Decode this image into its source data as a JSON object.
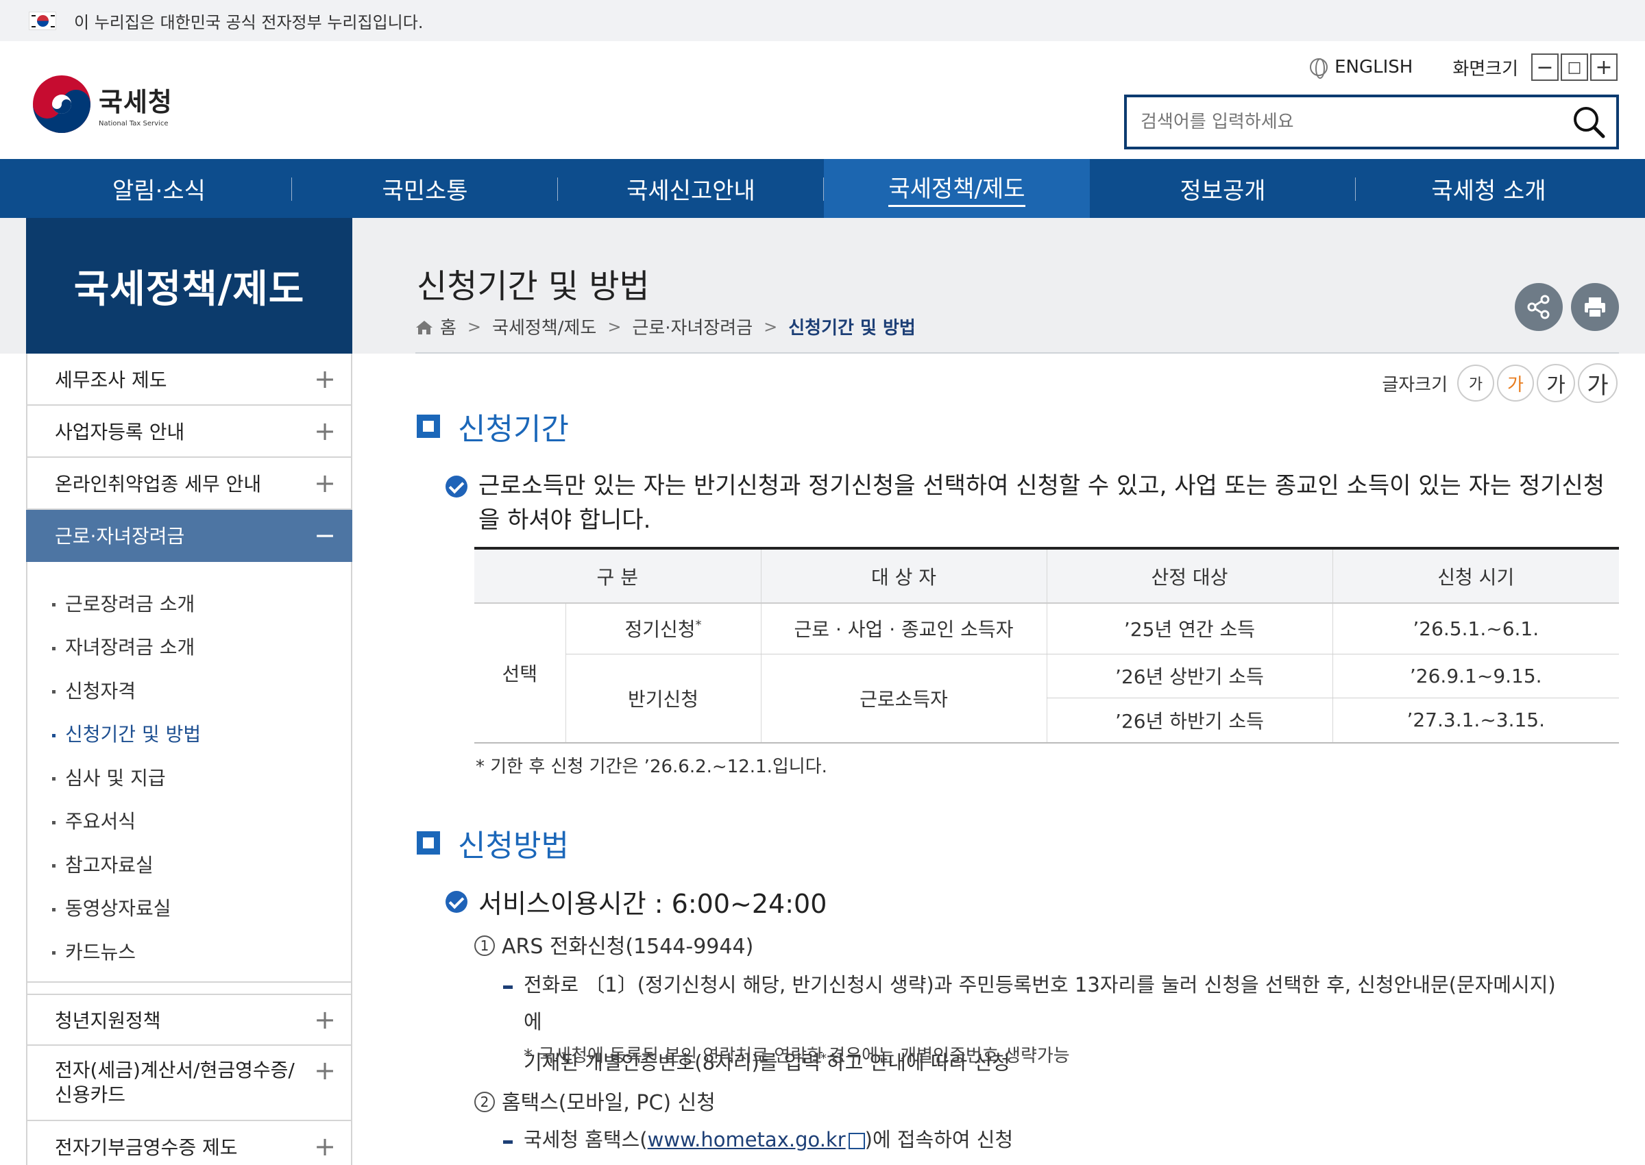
{
  "gov_banner": {
    "text": "이 누리집은 대한민국 공식 전자정부 누리집입니다."
  },
  "header": {
    "logo_ko": "국세청",
    "logo_en": "National Tax Service",
    "english_label": "ENGLISH",
    "zoom_label": "화면크기",
    "zoom_out": "−",
    "zoom_reset": "□",
    "zoom_in": "+",
    "search_placeholder": "검색어를 입력하세요"
  },
  "gnb": {
    "items": [
      {
        "label": "알림·소식"
      },
      {
        "label": "국민소통"
      },
      {
        "label": "국세신고안내"
      },
      {
        "label": "국세정책/제도",
        "active": true
      },
      {
        "label": "정보공개"
      },
      {
        "label": "국세청 소개"
      }
    ]
  },
  "lnb": {
    "title": "국세정책/제도",
    "items": [
      {
        "label": "세무조사 제도",
        "icon": "+"
      },
      {
        "label": "사업자등록 안내",
        "icon": "+"
      },
      {
        "label": "온라인취약업종 세무 안내",
        "icon": "+"
      },
      {
        "label": "근로·자녀장려금",
        "icon": "−",
        "active": true
      }
    ],
    "sub_items": [
      {
        "label": "근로장려금 소개"
      },
      {
        "label": "자녀장려금 소개"
      },
      {
        "label": "신청자격"
      },
      {
        "label": "신청기간 및 방법",
        "active": true
      },
      {
        "label": "심사 및 지급"
      },
      {
        "label": "주요서식"
      },
      {
        "label": "참고자료실"
      },
      {
        "label": "동영상자료실"
      },
      {
        "label": "카드뉴스"
      }
    ],
    "items_after": [
      {
        "label": "청년지원정책",
        "icon": "+"
      },
      {
        "label": "전자(세금)계산서/현금영수증/\n신용카드",
        "icon": "+"
      },
      {
        "label": "전자기부금영수증 제도",
        "icon": "+"
      }
    ]
  },
  "content": {
    "title": "신청기간 및 방법",
    "breadcrumb": [
      "홈",
      "국세정책/제도",
      "근로·자녀장려금",
      "신청기간 및 방법"
    ],
    "fontsize_label": "글자크기",
    "fontsize_buttons": [
      "가",
      "가",
      "가",
      "가"
    ],
    "section1": {
      "heading": "신청기간",
      "text": "근로소득만 있는 자는 반기신청과 정기신청을 선택하여 신청할 수 있고, 사업 또는 종교인 소득이 있는 자는 정기신청을 하셔야 합니다.",
      "table": {
        "headers": [
          "구 분",
          "대 상 자",
          "산정 대상",
          "신청 시기"
        ],
        "group": "선택",
        "rows": [
          {
            "type": "정기신청",
            "sup": "*",
            "target": "근로 · 사업 · 종교인 소득자",
            "basis": "’25년 연간 소득",
            "period": "’26.5.1.~6.1."
          },
          {
            "type": "반기신청",
            "target": "근로소득자",
            "basis": "’26년 상반기 소득",
            "period": "’26.9.1~9.15."
          },
          {
            "basis": "’26년 하반기 소득",
            "period": "’27.3.1.~3.15."
          }
        ]
      },
      "note": "* 기한 후 신청 기간은 ’26.6.2.~12.1.입니다."
    },
    "section2": {
      "heading": "신청방법",
      "service_time": "서비스이용시간 : 6:00~24:00",
      "method1": {
        "num": "1",
        "title": "ARS 전화신청(1544-9944)",
        "line1": "전화로 〔1〕(정기신청시 해당, 반기신청시 생략)과 주민등록번호 13자리를 눌러 신청을 선택한 후, 신청안내문(문자메시지)에",
        "line2_a": "기재된 개별인증번호(8자리)를 입력",
        "line2_sup": "*",
        "line2_b": "하고 안내에 따라 신청",
        "note": "* 국세청에 등록된 본인 연락처로 연락한 경우에는 개별인증번호 생략가능"
      },
      "method2": {
        "num": "2",
        "title": "홈택스(모바일, PC) 신청",
        "line_a": "국세청 홈택스(",
        "link": "www.hometax.go.kr",
        "line_b": ")에 접속하여 신청"
      }
    }
  },
  "colors": {
    "nav_blue": "#0d4d8d",
    "nav_active": "#1c66b0",
    "lnb_title": "#0c3b6c",
    "lnb_active": "#4d75a3",
    "accent": "#1b67b9",
    "fontsize_active": "#e87c1e"
  }
}
